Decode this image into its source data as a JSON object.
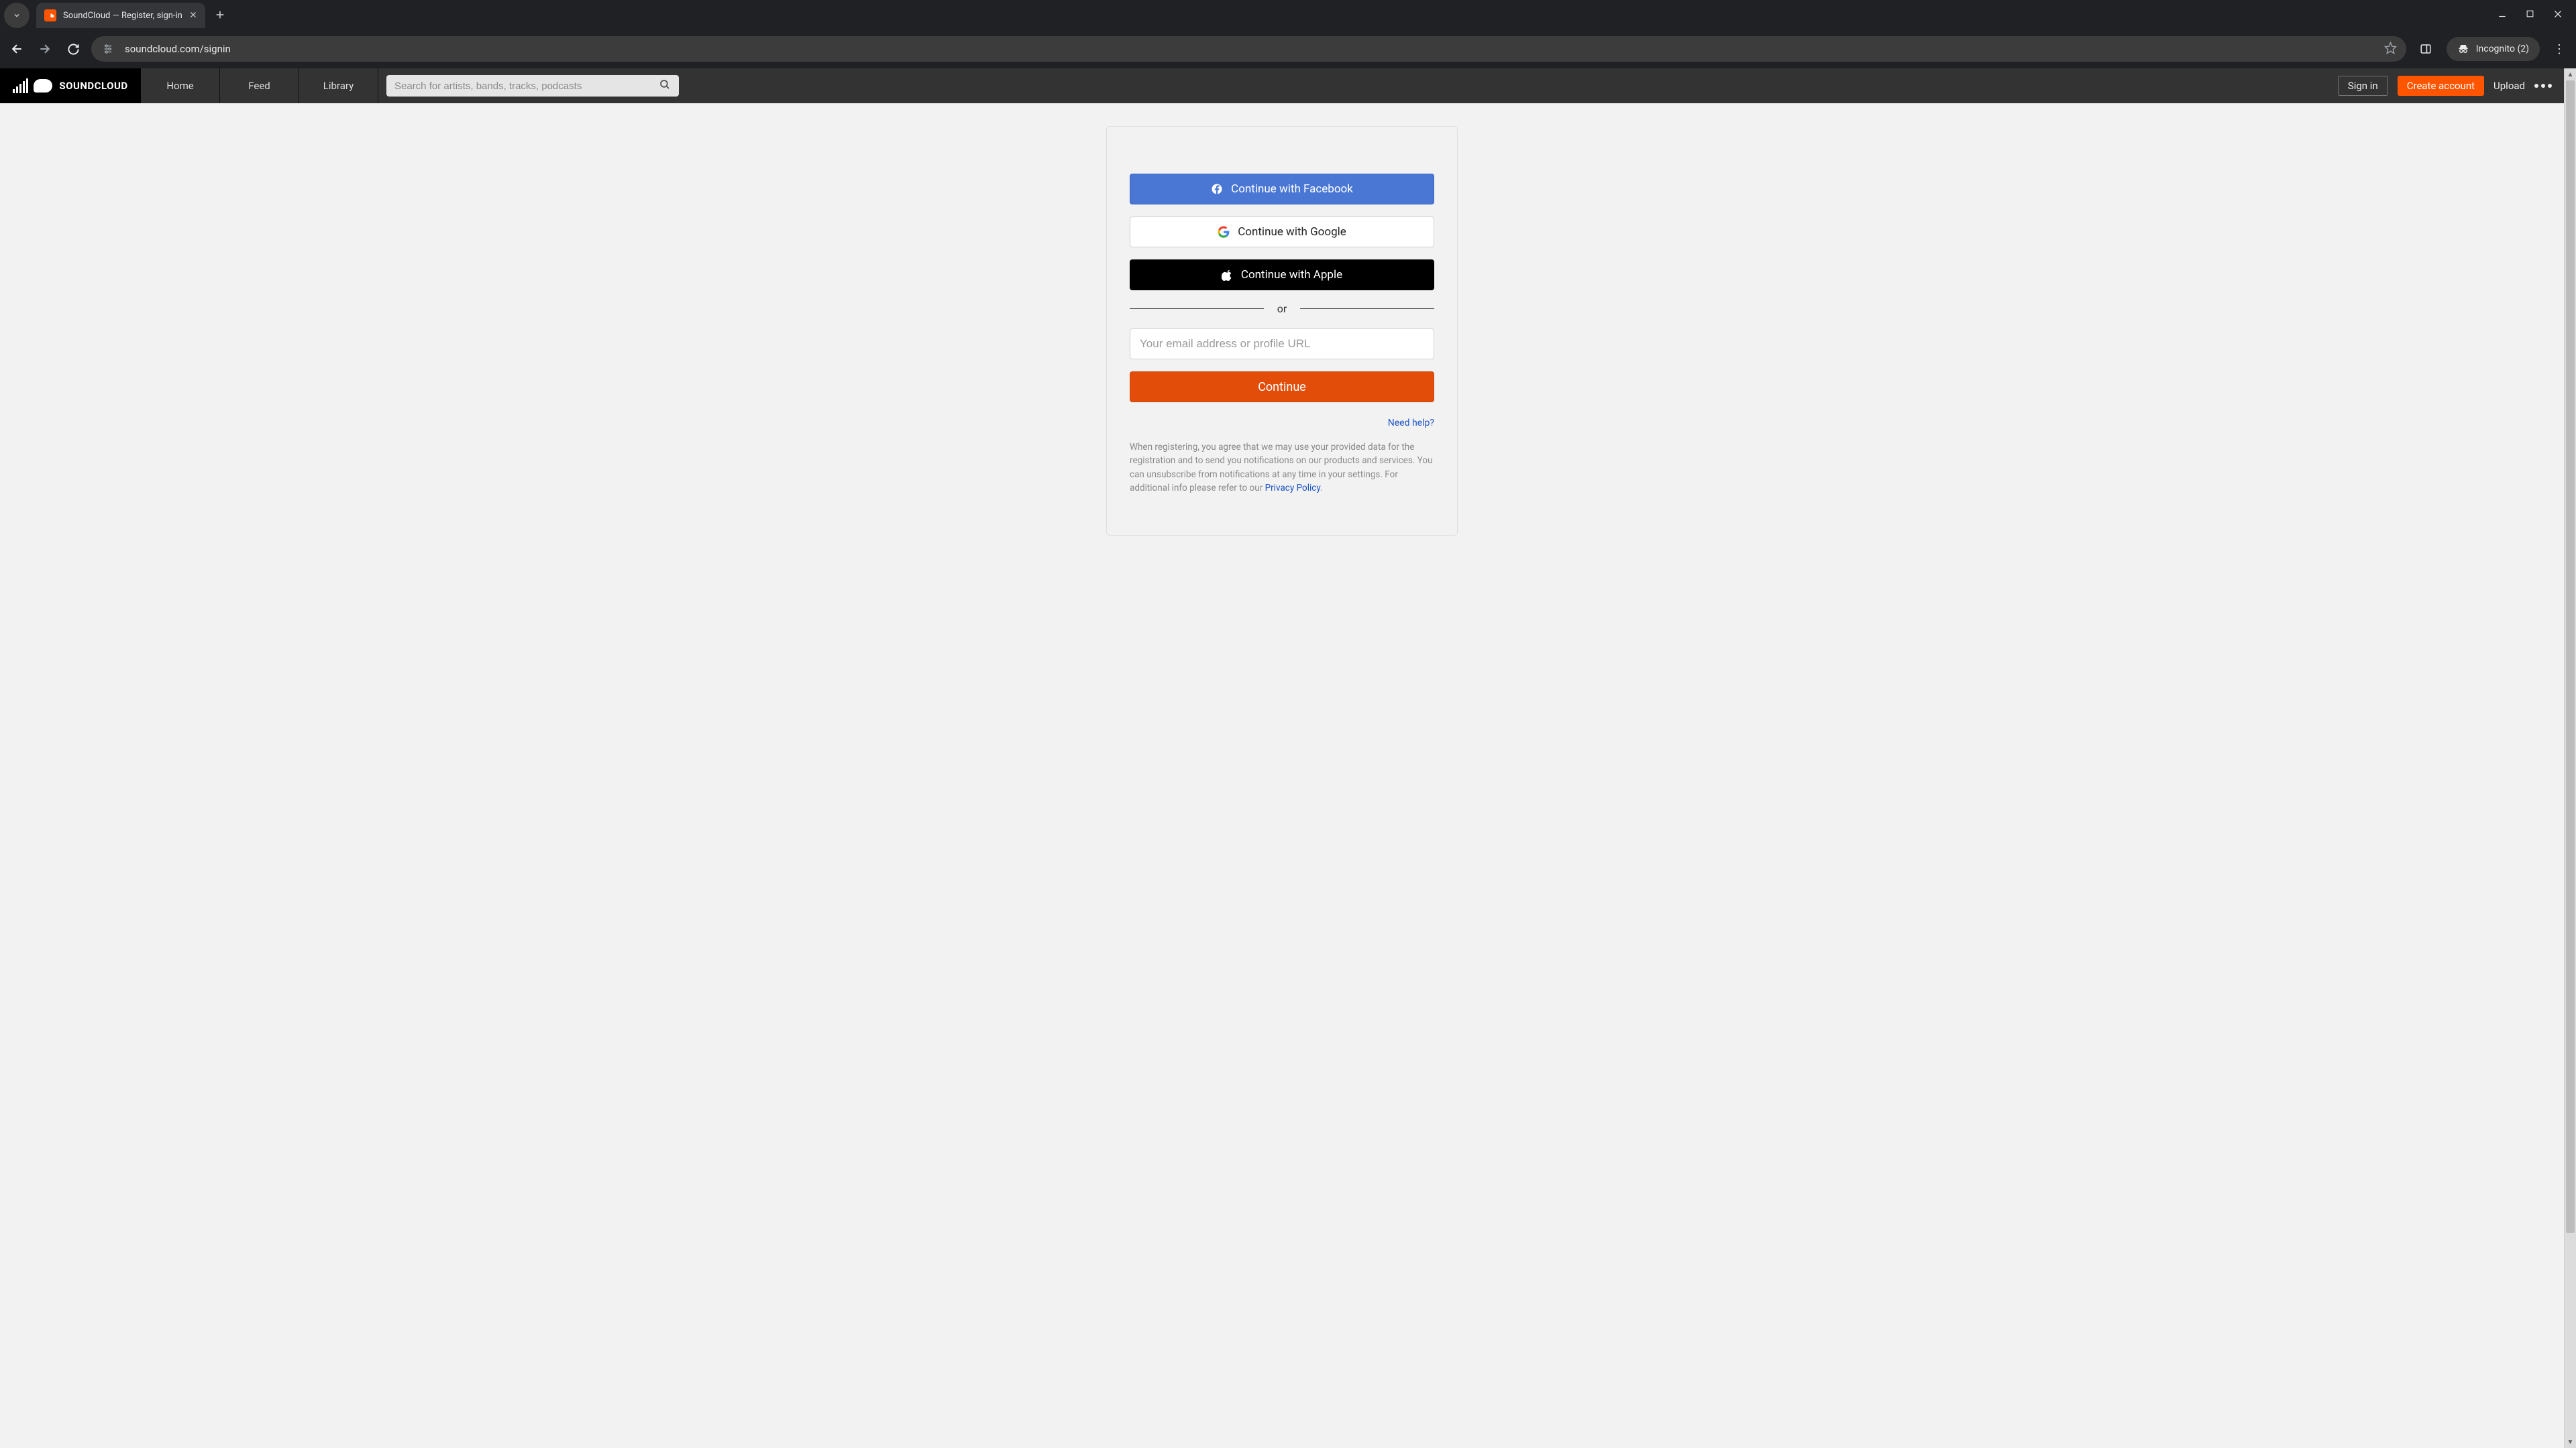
{
  "browser": {
    "tab_title": "SoundCloud — Register, sign-in",
    "url": "soundcloud.com/signin",
    "incognito_label": "Incognito (2)"
  },
  "sc_header": {
    "brand": "SOUNDCLOUD",
    "nav": {
      "home": "Home",
      "feed": "Feed",
      "library": "Library"
    },
    "search_placeholder": "Search for artists, bands, tracks, podcasts",
    "sign_in": "Sign in",
    "create_account": "Create account",
    "upload": "Upload"
  },
  "signin": {
    "facebook": "Continue with Facebook",
    "google": "Continue with Google",
    "apple": "Continue with Apple",
    "or": "or",
    "email_placeholder": "Your email address or profile URL",
    "continue": "Continue",
    "need_help": "Need help?",
    "legal_pre": "When registering, you agree that we may use your provided data for the registration and to send you notifications on our products and services. You can unsubscribe from notifications at any time in your settings. For additional info please refer to our ",
    "privacy": "Privacy Policy",
    "legal_post": "."
  }
}
